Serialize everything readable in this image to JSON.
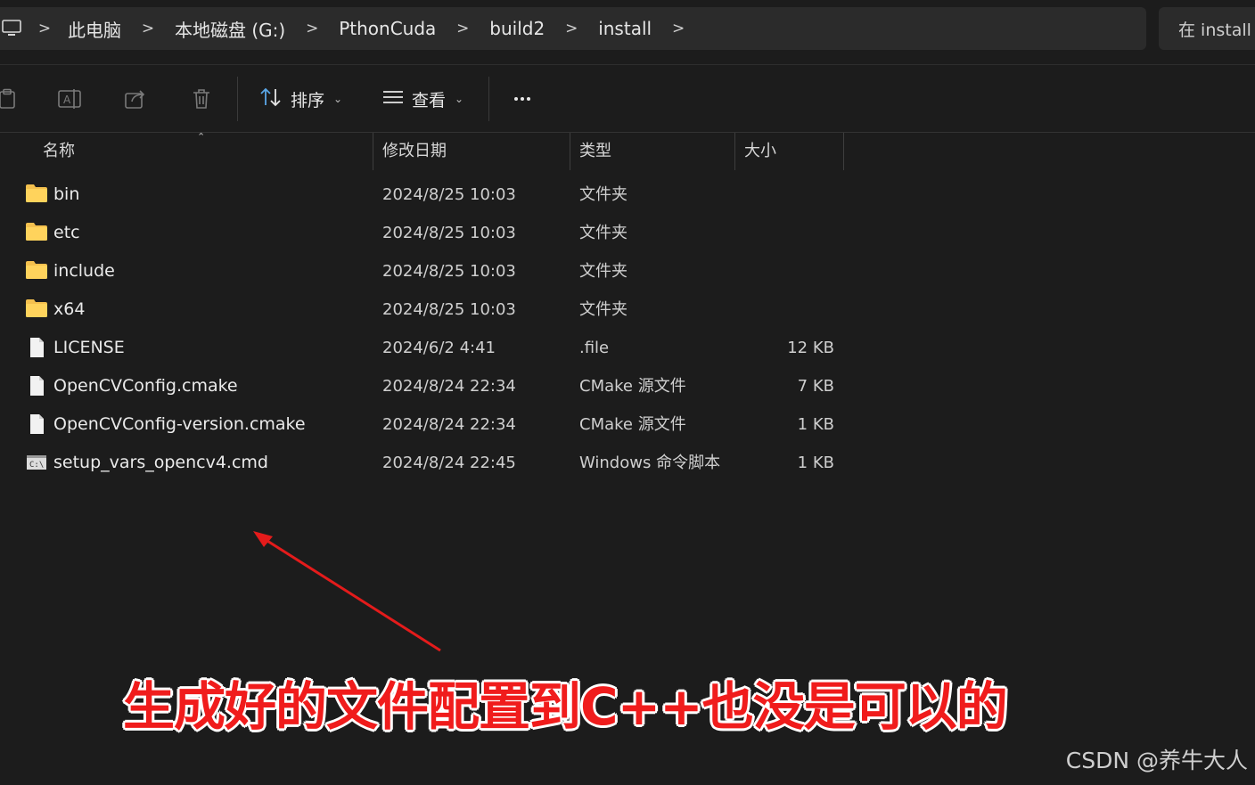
{
  "address_bar": {
    "pc_icon": "computer-icon",
    "breadcrumbs": [
      "此电脑",
      "本地磁盘 (G:)",
      "PthonCuda",
      "build2",
      "install"
    ],
    "separator": ">",
    "search_placeholder": "在 install"
  },
  "toolbar": {
    "icons": [
      "paste-icon",
      "rename-icon",
      "share-icon",
      "delete-icon"
    ],
    "sort_label": "排序",
    "view_label": "查看",
    "more_label": "..."
  },
  "columns": {
    "name": "名称",
    "date": "修改日期",
    "type": "类型",
    "size": "大小"
  },
  "files": [
    {
      "icon": "folder-icon",
      "name": "bin",
      "date": "2024/8/25 10:03",
      "type": "文件夹",
      "size": ""
    },
    {
      "icon": "folder-icon",
      "name": "etc",
      "date": "2024/8/25 10:03",
      "type": "文件夹",
      "size": ""
    },
    {
      "icon": "folder-icon",
      "name": "include",
      "date": "2024/8/25 10:03",
      "type": "文件夹",
      "size": ""
    },
    {
      "icon": "folder-icon",
      "name": "x64",
      "date": "2024/8/25 10:03",
      "type": "文件夹",
      "size": ""
    },
    {
      "icon": "file-icon",
      "name": "LICENSE",
      "date": "2024/6/2 4:41",
      "type": ".file",
      "size": "12 KB"
    },
    {
      "icon": "file-icon",
      "name": "OpenCVConfig.cmake",
      "date": "2024/8/24 22:34",
      "type": "CMake 源文件",
      "size": "7 KB"
    },
    {
      "icon": "file-icon",
      "name": "OpenCVConfig-version.cmake",
      "date": "2024/8/24 22:34",
      "type": "CMake 源文件",
      "size": "1 KB"
    },
    {
      "icon": "script-icon",
      "name": "setup_vars_opencv4.cmd",
      "date": "2024/8/24 22:45",
      "type": "Windows 命令脚本",
      "size": "1 KB"
    }
  ],
  "annotation": {
    "caption": "生成好的文件配置到C++也没是可以的",
    "color": "#f01c1c"
  },
  "watermark": "CSDN @养牛大人"
}
